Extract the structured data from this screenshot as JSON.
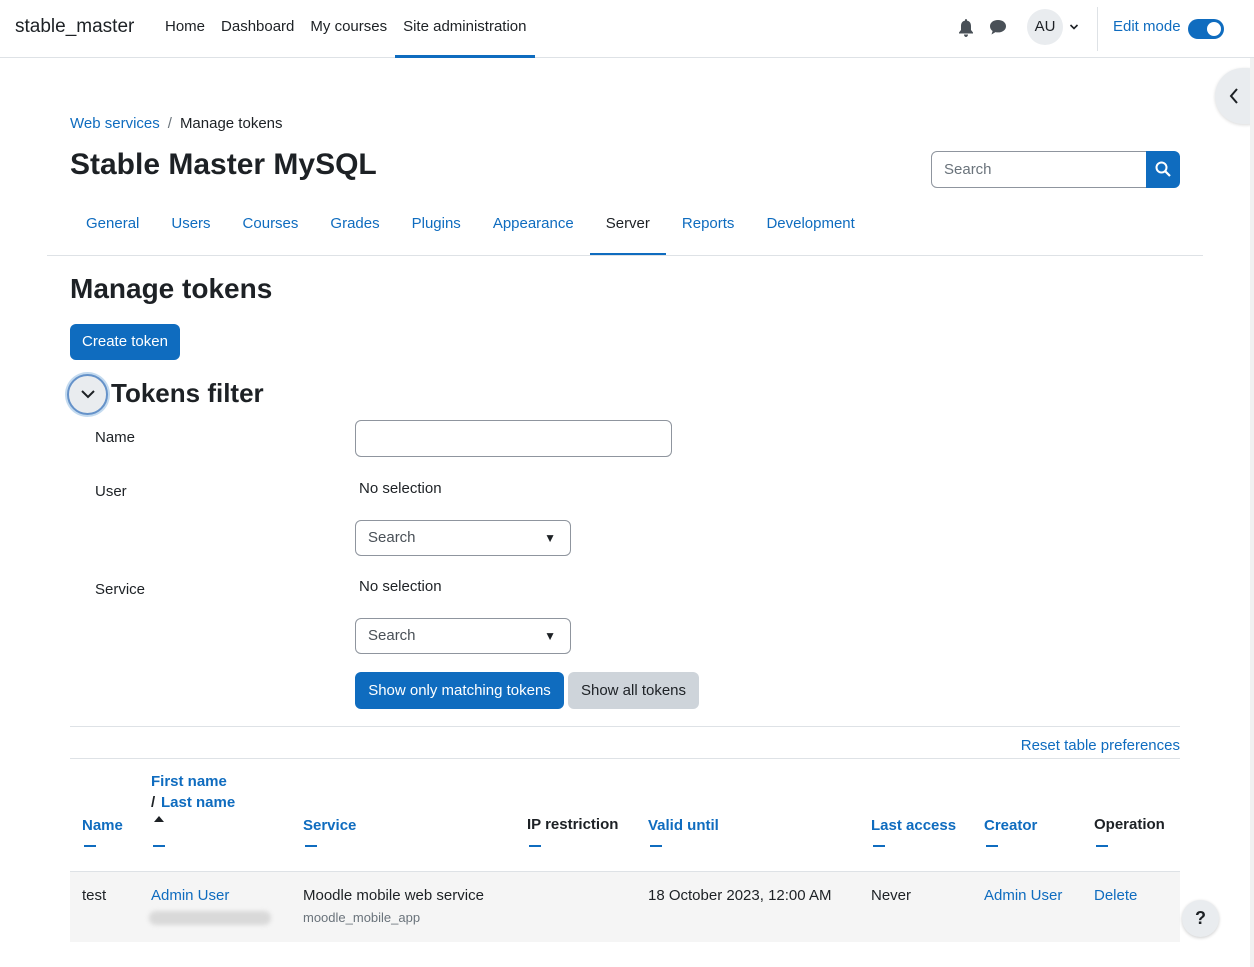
{
  "navbar": {
    "brand": "stable_master",
    "items": [
      {
        "label": "Home"
      },
      {
        "label": "Dashboard"
      },
      {
        "label": "My courses"
      },
      {
        "label": "Site administration",
        "active": true
      }
    ],
    "avatar_initials": "AU",
    "edit_mode_label": "Edit mode",
    "edit_mode_on": true
  },
  "breadcrumb": {
    "parent": "Web services",
    "separator": "/",
    "current": "Manage tokens"
  },
  "header": {
    "title": "Stable Master MySQL",
    "search_placeholder": "Search"
  },
  "secondary_nav": {
    "tabs": [
      {
        "label": "General"
      },
      {
        "label": "Users"
      },
      {
        "label": "Courses"
      },
      {
        "label": "Grades"
      },
      {
        "label": "Plugins"
      },
      {
        "label": "Appearance"
      },
      {
        "label": "Server",
        "active": true
      },
      {
        "label": "Reports"
      },
      {
        "label": "Development"
      }
    ]
  },
  "main": {
    "heading": "Manage tokens",
    "create_button": "Create token",
    "filter": {
      "title": "Tokens filter",
      "name_label": "Name",
      "name_value": "",
      "user_label": "User",
      "user_selection": "No selection",
      "user_search_placeholder": "Search",
      "service_label": "Service",
      "service_selection": "No selection",
      "service_search_placeholder": "Search",
      "match_button": "Show only matching tokens",
      "show_all_button": "Show all tokens"
    },
    "reset_link": "Reset table preferences",
    "table": {
      "headers": {
        "name": "Name",
        "first_name": "First name",
        "last_name_prefix": "/ ",
        "last_name": "Last name",
        "service": "Service",
        "ip_restriction": "IP restriction",
        "valid_until": "Valid until",
        "last_access": "Last access",
        "creator": "Creator",
        "operation": "Operation"
      },
      "rows": [
        {
          "name": "test",
          "user": "Admin User",
          "service": "Moodle mobile web service",
          "service_shortname": "moodle_mobile_app",
          "ip_restriction": "",
          "valid_until": "18 October 2023, 12:00 AM",
          "last_access": "Never",
          "creator": "Admin User",
          "operation": "Delete"
        }
      ]
    }
  },
  "help_button": "?",
  "colors": {
    "accent": "#0f6cbf",
    "text": "#1d2125",
    "secondary_button": "#ced4da"
  }
}
